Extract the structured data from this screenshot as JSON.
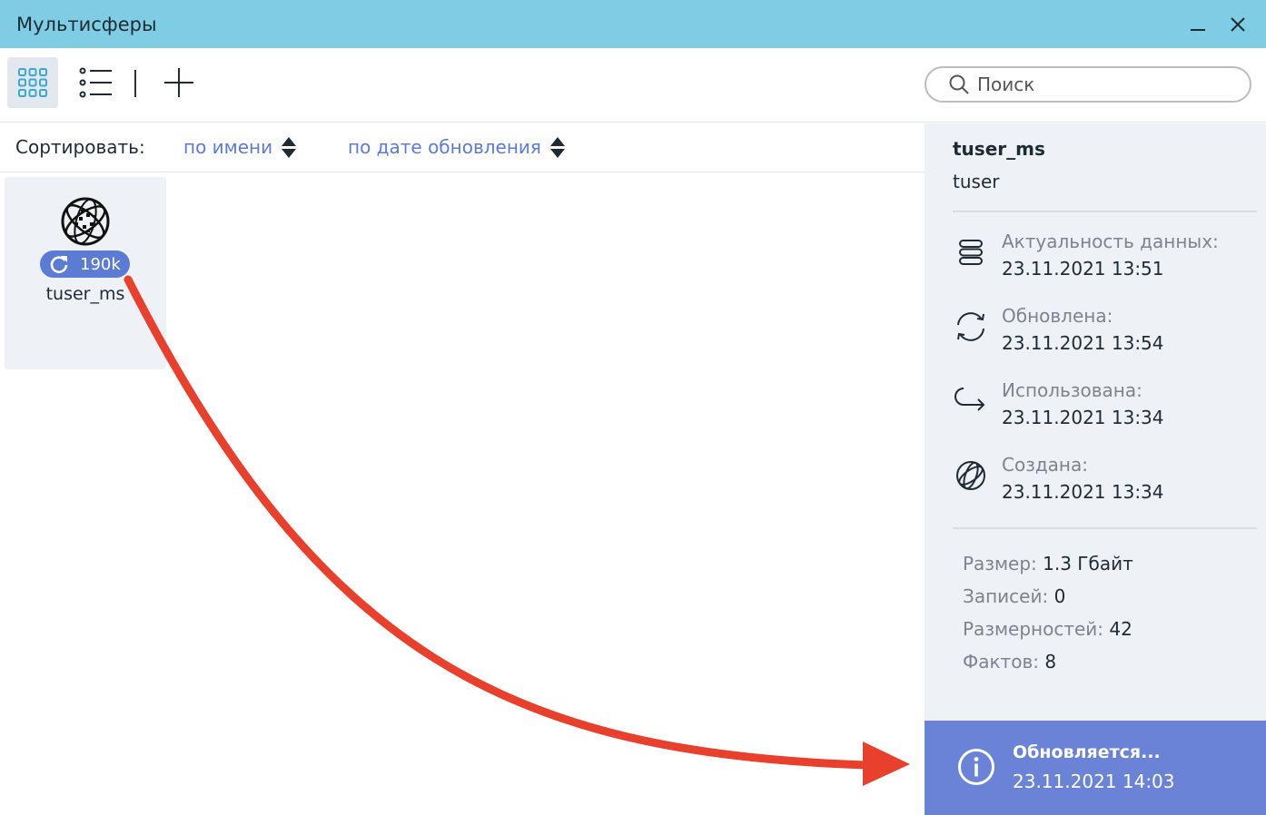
{
  "window": {
    "title": "Мультисферы",
    "minimize_icon": "minimize-icon",
    "close_icon": "close-icon"
  },
  "toolbar": {
    "grid_view_icon": "grid-view-icon",
    "list_view_icon": "list-view-icon",
    "add_icon": "plus-icon",
    "search": {
      "placeholder": "Поиск",
      "value": "",
      "icon": "search-icon"
    }
  },
  "sort": {
    "label": "Сортировать:",
    "by_name": "по имени",
    "by_date": "по дате обновления"
  },
  "tiles": [
    {
      "name": "tuser_ms",
      "badge": "190k",
      "icon": "sphere-globe-icon",
      "badge_icon": "refresh-icon"
    }
  ],
  "panel": {
    "title": "tuser_ms",
    "owner": "tuser",
    "rows": [
      {
        "icon": "database-icon",
        "label": "Актуальность данных:",
        "value": "23.11.2021 13:51"
      },
      {
        "icon": "sync-icon",
        "label": "Обновлена:",
        "value": "23.11.2021 13:54"
      },
      {
        "icon": "redo-arrow-icon",
        "label": "Использована:",
        "value": "23.11.2021 13:34"
      },
      {
        "icon": "globe-icon",
        "label": "Создана:",
        "value": "23.11.2021 13:34"
      }
    ],
    "stats": [
      {
        "key": "Размер:",
        "value": "1.3 Гбайт"
      },
      {
        "key": "Записей:",
        "value": "0"
      },
      {
        "key": "Размерностей:",
        "value": "42"
      },
      {
        "key": "Фактов:",
        "value": "8"
      }
    ]
  },
  "status": {
    "icon": "info-icon",
    "title": "Обновляется...",
    "time": "23.11.2021 14:03"
  },
  "colors": {
    "titlebar": "#7fcde4",
    "accent": "#5b7bd5",
    "status_bg": "#6b83d6",
    "annotation_arrow": "#e8402d"
  }
}
